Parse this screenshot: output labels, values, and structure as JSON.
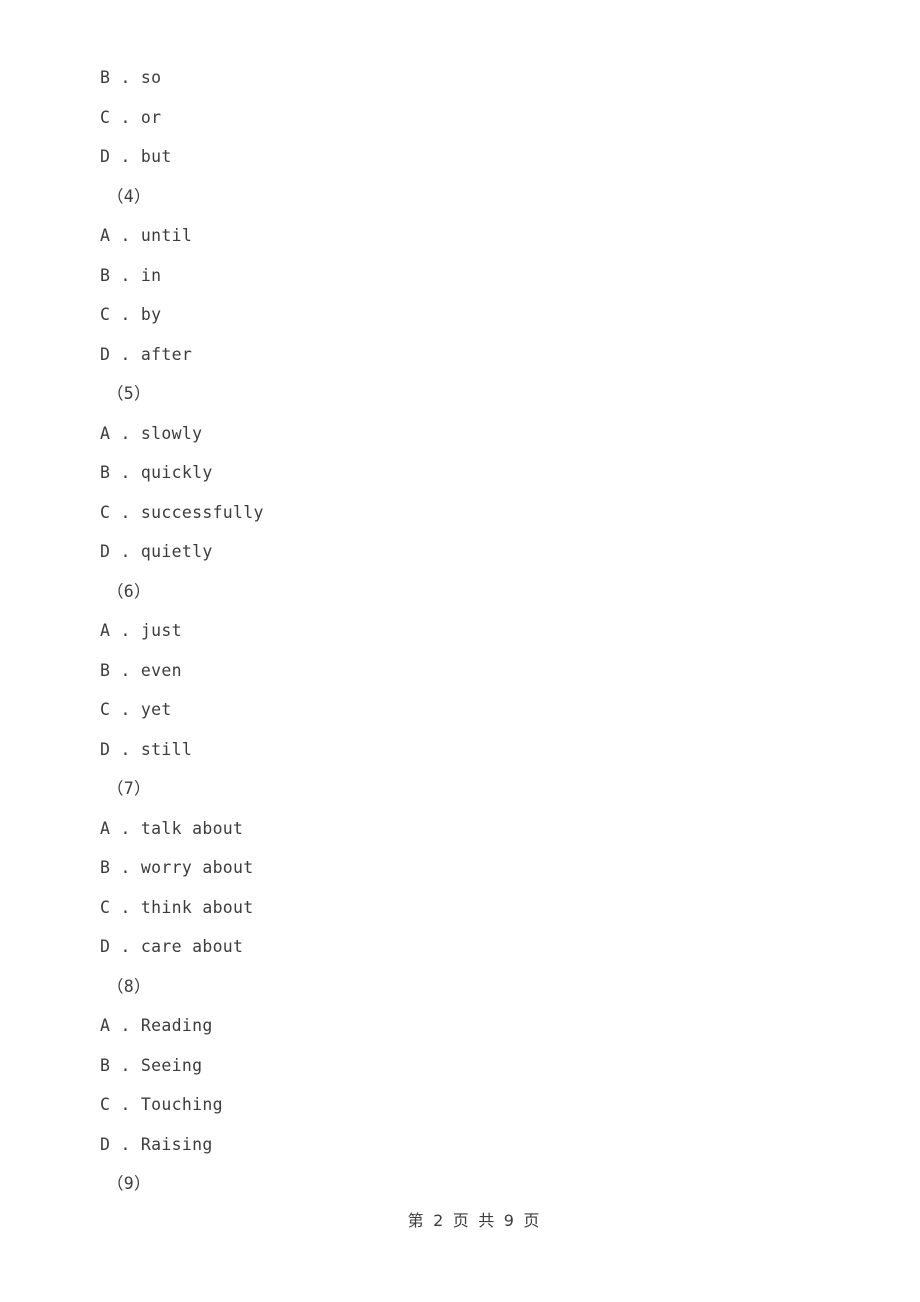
{
  "document": {
    "page_label": "第 2 页 共 9 页",
    "page_number": "2",
    "total_pages": "9",
    "text_color": "#3c3c3c",
    "background_color": "#ffffff"
  },
  "lines": [
    {
      "type": "option",
      "text": "B . so"
    },
    {
      "type": "option",
      "text": "C . or"
    },
    {
      "type": "option",
      "text": "D . but"
    },
    {
      "type": "qnum",
      "text": "（4）"
    },
    {
      "type": "option",
      "text": "A . until"
    },
    {
      "type": "option",
      "text": "B . in"
    },
    {
      "type": "option",
      "text": "C . by"
    },
    {
      "type": "option",
      "text": "D . after"
    },
    {
      "type": "qnum",
      "text": "（5）"
    },
    {
      "type": "option",
      "text": "A . slowly"
    },
    {
      "type": "option",
      "text": "B . quickly"
    },
    {
      "type": "option",
      "text": "C . successfully"
    },
    {
      "type": "option",
      "text": "D . quietly"
    },
    {
      "type": "qnum",
      "text": "（6）"
    },
    {
      "type": "option",
      "text": "A . just"
    },
    {
      "type": "option",
      "text": "B . even"
    },
    {
      "type": "option",
      "text": "C . yet"
    },
    {
      "type": "option",
      "text": "D . still"
    },
    {
      "type": "qnum",
      "text": "（7）"
    },
    {
      "type": "option",
      "text": "A . talk about"
    },
    {
      "type": "option",
      "text": "B . worry about"
    },
    {
      "type": "option",
      "text": "C . think about"
    },
    {
      "type": "option",
      "text": "D . care about"
    },
    {
      "type": "qnum",
      "text": "（8）"
    },
    {
      "type": "option",
      "text": "A . Reading"
    },
    {
      "type": "option",
      "text": "B . Seeing"
    },
    {
      "type": "option",
      "text": "C . Touching"
    },
    {
      "type": "option",
      "text": "D . Raising"
    },
    {
      "type": "qnum",
      "text": "（9）"
    }
  ]
}
